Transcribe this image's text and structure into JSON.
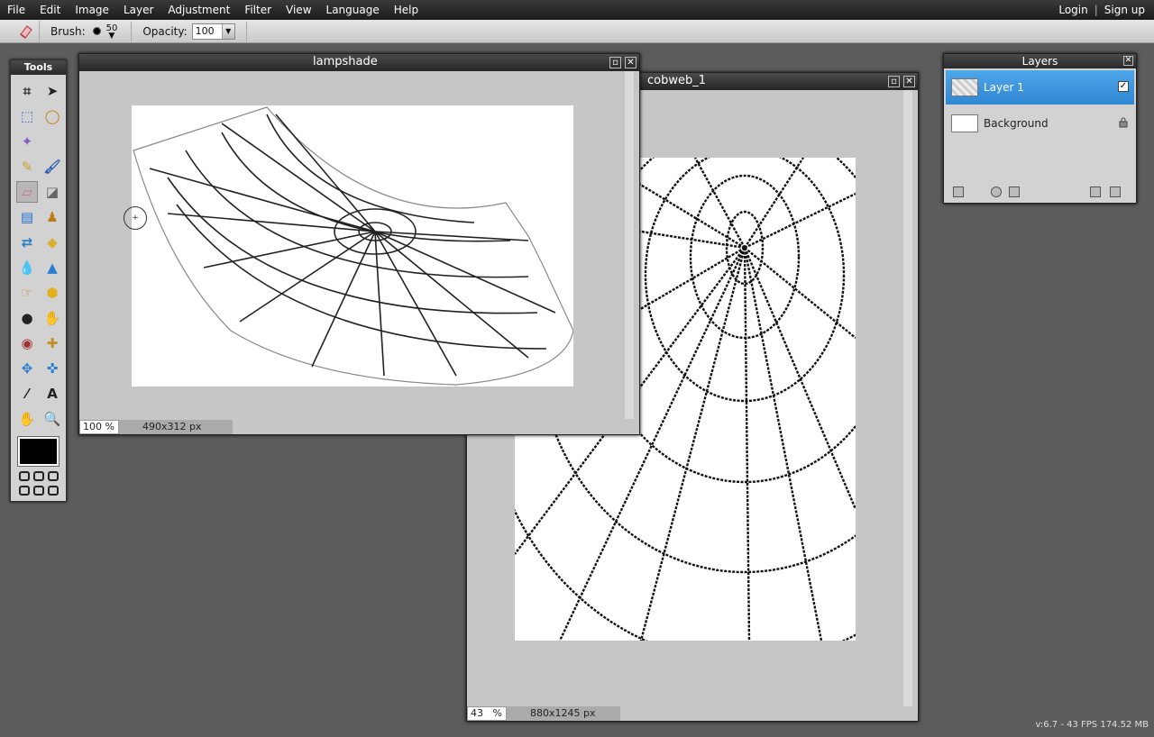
{
  "menubar": {
    "items": [
      "File",
      "Edit",
      "Image",
      "Layer",
      "Adjustment",
      "Filter",
      "View",
      "Language",
      "Help"
    ],
    "login": "Login",
    "separator": "|",
    "signup": "Sign up"
  },
  "options": {
    "brush_label": "Brush:",
    "brush_size": "50",
    "opacity_label": "Opacity:",
    "opacity_value": "100"
  },
  "tools": {
    "title": "Tools",
    "icons": [
      "crop-icon",
      "move-icon",
      "marquee-icon",
      "lasso-icon",
      "magic-wand-icon",
      "pencil-icon",
      "brush-icon",
      "eraser-icon",
      "paint-bucket-icon",
      "gradient-icon",
      "clone-stamp-icon",
      "color-replace-icon",
      "drawing-icon",
      "blur-icon",
      "sharpen-icon",
      "smudge-icon",
      "sponge-icon",
      "dodge-icon",
      "burn-icon",
      "red-eye-icon",
      "spot-heal-icon",
      "bloat-icon",
      "pinch-icon",
      "color-picker-icon",
      "type-icon",
      "hand-icon",
      "zoom-icon"
    ],
    "active": "eraser-icon",
    "foreground_color": "#000000"
  },
  "windows": [
    {
      "title": "cobweb_1",
      "zoom": "43",
      "zoom_unit": "%",
      "dimensions": "880x1245 px"
    },
    {
      "title": "lampshade",
      "zoom": "100",
      "zoom_unit": "%",
      "dimensions": "490x312 px"
    }
  ],
  "layers": {
    "title": "Layers",
    "items": [
      {
        "name": "Layer 1",
        "selected": true,
        "right_icon": "visible-check-icon"
      },
      {
        "name": "Background",
        "selected": false,
        "right_icon": "lock-icon"
      }
    ]
  },
  "status": {
    "version": "v:6.7 - 43 FPS 174.52 MB"
  },
  "colors": {
    "accent": "#3b93dd",
    "workspace": "#5c5c5c"
  }
}
